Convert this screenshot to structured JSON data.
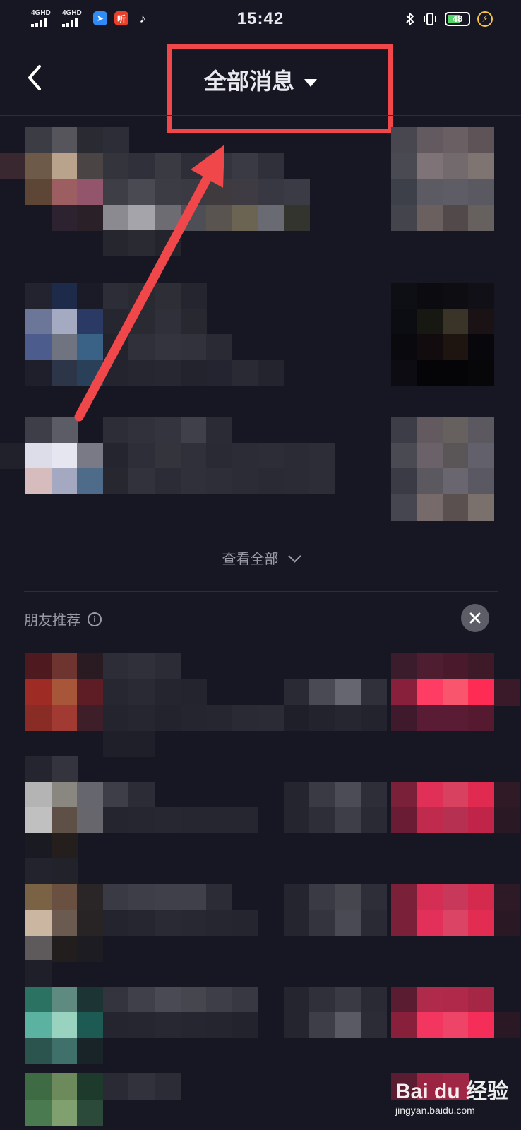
{
  "status_bar": {
    "network_1": "4GHD",
    "network_2": "4GHD",
    "time": "15:42",
    "battery": "48",
    "apps": [
      {
        "name": "feishu-icon",
        "color": "#2f8cf6",
        "glyph": "➤"
      },
      {
        "name": "listen-app-icon",
        "color": "#e8402a",
        "glyph": "听"
      },
      {
        "name": "tiktok-icon",
        "color": "transparent",
        "glyph": "♪"
      }
    ]
  },
  "header": {
    "title": "全部消息"
  },
  "messages": {
    "view_all": "查看全部"
  },
  "recommend": {
    "section_title": "朋友推荐",
    "info_glyph": "i"
  },
  "watermark": {
    "logo_text": "Bai du 经验",
    "url": "jingyan.baidu.com"
  },
  "colors": {
    "background": "#161722",
    "highlight": "#f0474a",
    "accent_pink": "#fe2c55"
  },
  "annotation": {
    "highlight_color": "#f0474a"
  }
}
